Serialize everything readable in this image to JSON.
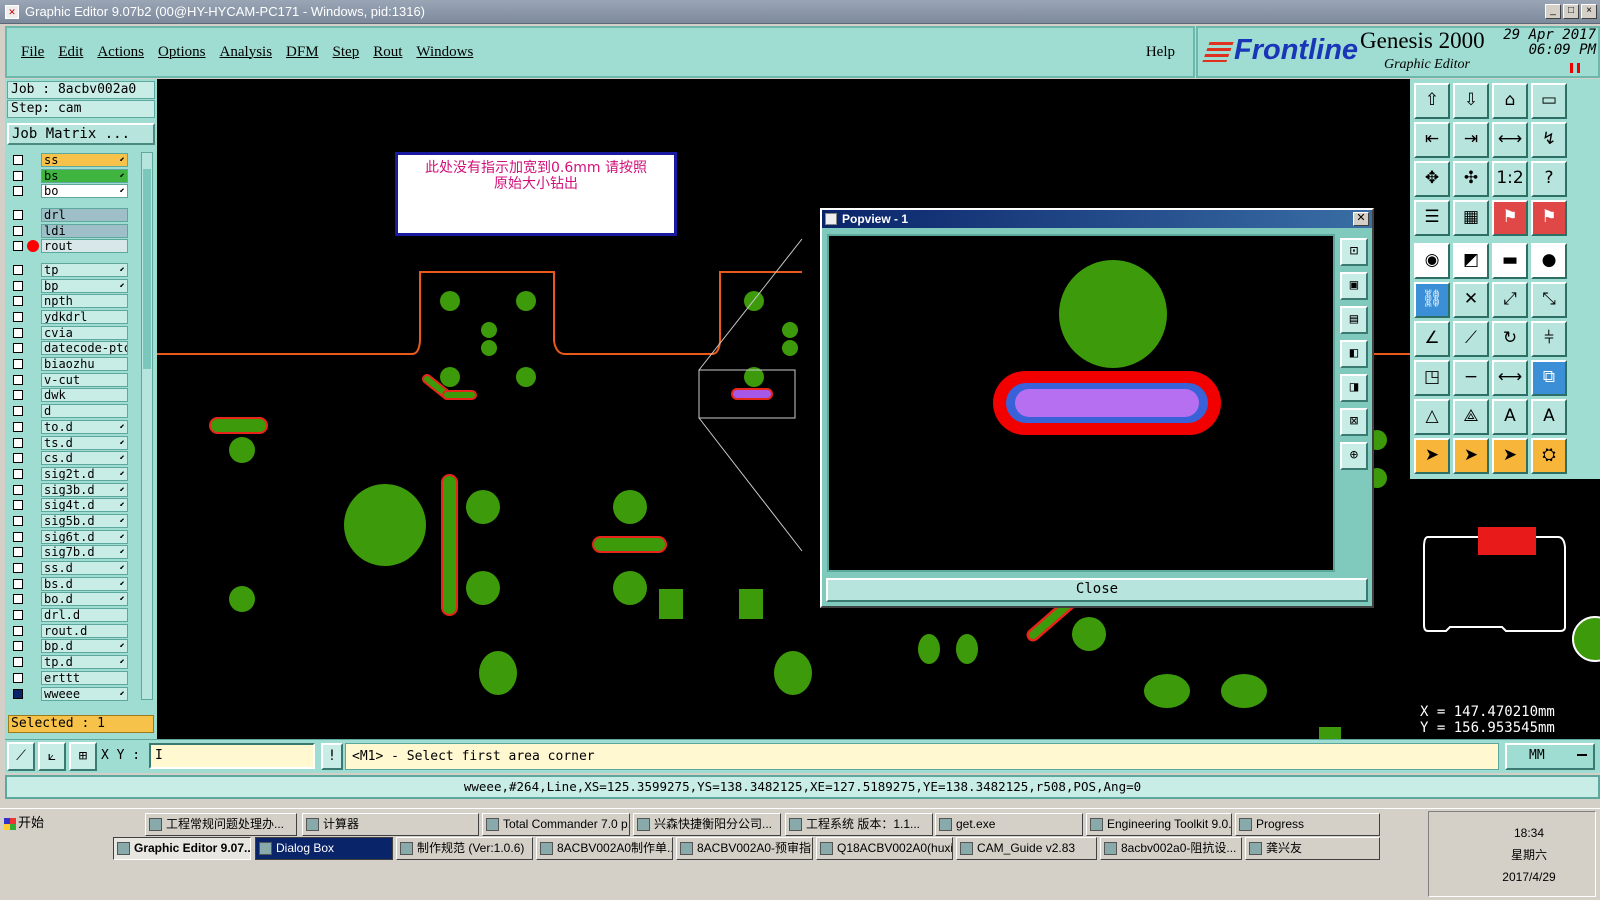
{
  "window": {
    "title": "Graphic Editor 9.07b2 (00@HY-HYCAM-PC171 - Windows, pid:1316)"
  },
  "menu": {
    "items": [
      "File",
      "Edit",
      "Actions",
      "Options",
      "Analysis",
      "DFM",
      "Step",
      "Rout",
      "Windows"
    ],
    "help": "Help"
  },
  "brand": {
    "logo": "Frontline",
    "product": "Genesis 2000",
    "subtitle": "Graphic Editor",
    "date": "29 Apr 2017",
    "time": "06:09 PM"
  },
  "job": {
    "job_label": "Job : 8acbv002a0",
    "step_label": "Step: cam",
    "matrix_button": "Job Matrix ..."
  },
  "layers": [
    {
      "name": "ss",
      "color": "#f6c24a",
      "board": true
    },
    {
      "name": "bs",
      "color": "#3fb53f",
      "board": true
    },
    {
      "name": "bo",
      "color": "#ffffff",
      "board": true
    },
    {
      "sep": true
    },
    {
      "name": "drl",
      "color": "#9fbfc8",
      "board": false
    },
    {
      "name": "ldi",
      "color": "#9fbfc8",
      "board": false
    },
    {
      "name": "rout",
      "color": "#d8e8ea",
      "board": false,
      "red": true
    },
    {
      "sep": true
    },
    {
      "name": "tp",
      "color": "#c8ece6",
      "board": true
    },
    {
      "name": "bp",
      "color": "#c8ece6",
      "board": true
    },
    {
      "name": "npth",
      "color": "#c8ece6",
      "board": false
    },
    {
      "name": "ydkdrl",
      "color": "#c8ece6",
      "board": false
    },
    {
      "name": "cvia",
      "color": "#c8ece6",
      "board": false
    },
    {
      "name": "datecode-ptc",
      "color": "#c8ece6",
      "board": false
    },
    {
      "name": "biaozhu",
      "color": "#c8ece6",
      "board": false
    },
    {
      "name": "v-cut",
      "color": "#c8ece6",
      "board": false
    },
    {
      "name": "dwk",
      "color": "#c8ece6",
      "board": false
    },
    {
      "name": "d",
      "color": "#c8ece6",
      "board": false
    },
    {
      "name": "to.d",
      "color": "#c8ece6",
      "board": true
    },
    {
      "name": "ts.d",
      "color": "#c8ece6",
      "board": true
    },
    {
      "name": "cs.d",
      "color": "#c8ece6",
      "board": true
    },
    {
      "name": "sig2t.d",
      "color": "#c8ece6",
      "board": true
    },
    {
      "name": "sig3b.d",
      "color": "#c8ece6",
      "board": true
    },
    {
      "name": "sig4t.d",
      "color": "#c8ece6",
      "board": true
    },
    {
      "name": "sig5b.d",
      "color": "#c8ece6",
      "board": true
    },
    {
      "name": "sig6t.d",
      "color": "#c8ece6",
      "board": true
    },
    {
      "name": "sig7b.d",
      "color": "#c8ece6",
      "board": true
    },
    {
      "name": "ss.d",
      "color": "#c8ece6",
      "board": true
    },
    {
      "name": "bs.d",
      "color": "#c8ece6",
      "board": true
    },
    {
      "name": "bo.d",
      "color": "#c8ece6",
      "board": true
    },
    {
      "name": "drl.d",
      "color": "#c8ece6",
      "board": false
    },
    {
      "name": "rout.d",
      "color": "#c8ece6",
      "board": false
    },
    {
      "name": "bp.d",
      "color": "#c8ece6",
      "board": true
    },
    {
      "name": "tp.d",
      "color": "#c8ece6",
      "board": true
    },
    {
      "name": "erttt",
      "color": "#c8ece6",
      "board": false
    },
    {
      "name": "wweee",
      "color": "#c8ece6",
      "board": true,
      "active": true
    }
  ],
  "selected": "Selected : 1",
  "note": {
    "line1": "此处没有指示加宽到0.6mm  请按照",
    "line2": "原始大小钻出"
  },
  "popview": {
    "title": "Popview - 1",
    "close": "Close"
  },
  "coords": {
    "x": "X  =  147.470210mm",
    "y": "Y  =  156.953545mm"
  },
  "command": {
    "xy_label": "X Y :",
    "xy_value": "I",
    "prompt": "<M1> - Select first area corner",
    "unit": "MM"
  },
  "info": "wweee,#264,Line,XS=125.3599275,YS=138.3482125,XE=127.5189275,YE=138.3482125,r508,POS,Ang=0",
  "taskbar": {
    "start": "开始",
    "row1": [
      "工程常规问题处理办...",
      "计算器",
      "Total Commander 7.0 p...",
      "兴森快捷衡阳分公司...",
      "工程系统  版本：1.1...",
      "get.exe",
      "Engineering Toolkit 9.0...",
      "Progress"
    ],
    "row2": [
      "Graphic Editor 9.07...",
      "Dialog Box",
      "制作规范 (Ver:1.0.6)",
      "8ACBV002A0制作单....",
      "8ACBV002A0-预审指...",
      "Q18ACBV002A0(huxi...",
      "CAM_Guide v2.83",
      "8acbv002a0-阻抗设...",
      "龚兴友"
    ],
    "clock_time": "18:34",
    "clock_day": "星期六",
    "clock_date": "2017/4/29"
  }
}
